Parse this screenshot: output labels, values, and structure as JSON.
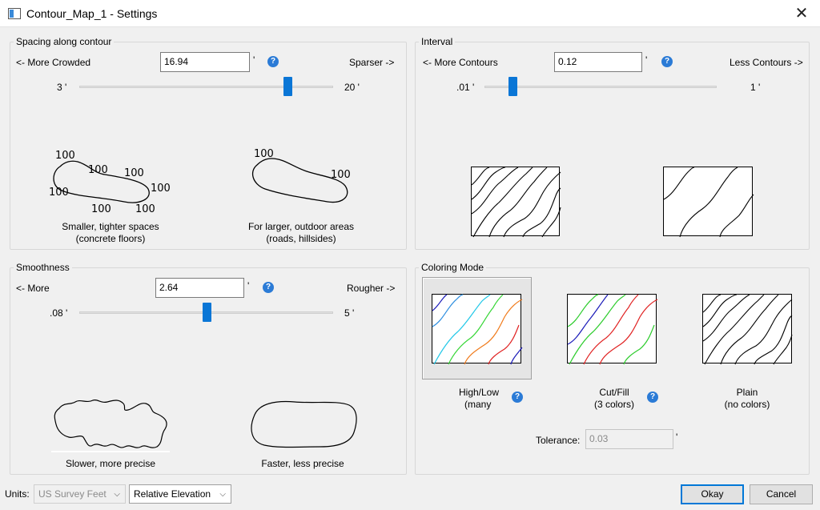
{
  "window": {
    "title": "Contour_Map_1 - Settings"
  },
  "spacing": {
    "group_label": "Spacing along contour",
    "left_label": "<- More Crowded",
    "right_label": "Sparser ->",
    "value": "16.94",
    "unit": "'",
    "min_label": "3 '",
    "max_label": "20 '",
    "slider_fraction": 0.82,
    "examples": [
      {
        "label_line1": "Smaller, tighter spaces",
        "label_line2": "(concrete floors)"
      },
      {
        "label_line1": "For larger, outdoor areas",
        "label_line2": "(roads, hillsides)"
      }
    ],
    "sketch_label": "100"
  },
  "interval": {
    "group_label": "Interval",
    "left_label": "<- More Contours",
    "right_label": "Less Contours ->",
    "value": "0.12",
    "unit": "'",
    "min_label": ".01 '",
    "max_label": "1 '",
    "slider_fraction": 0.12
  },
  "smoothness": {
    "group_label": "Smoothness",
    "left_label": "<- More",
    "right_label": "Rougher ->",
    "value": "2.64",
    "unit": "'",
    "min_label": ".08 '",
    "max_label": "5 '",
    "slider_fraction": 0.5,
    "examples": [
      {
        "label": "Slower, more precise"
      },
      {
        "label": "Faster, less precise"
      }
    ]
  },
  "coloring": {
    "group_label": "Coloring Mode",
    "selected": "high_low",
    "options": [
      {
        "id": "high_low",
        "label_line1": "High/Low",
        "label_line2": "(many"
      },
      {
        "id": "cut_fill",
        "label_line1": "Cut/Fill",
        "label_line2": "(3 colors)"
      },
      {
        "id": "plain",
        "label_line1": "Plain",
        "label_line2": "(no colors)"
      }
    ],
    "tolerance_label": "Tolerance:",
    "tolerance_value": "0.03",
    "tolerance_unit": "'"
  },
  "footer": {
    "units_label": "Units:",
    "units_value": "US Survey Feet",
    "elevation_value": "Relative Elevation",
    "okay_label": "Okay",
    "cancel_label": "Cancel"
  },
  "help_glyph": "?",
  "colors": {
    "accent": "#0a76d6",
    "help": "#2b7bd6",
    "hl_palette": [
      "#1a1ab8",
      "#2f8fe0",
      "#22c8e8",
      "#33d633",
      "#f07a1a",
      "#e02020"
    ],
    "cf_palette": [
      "#1a1ab8",
      "#2ccc2c",
      "#e02020"
    ]
  }
}
